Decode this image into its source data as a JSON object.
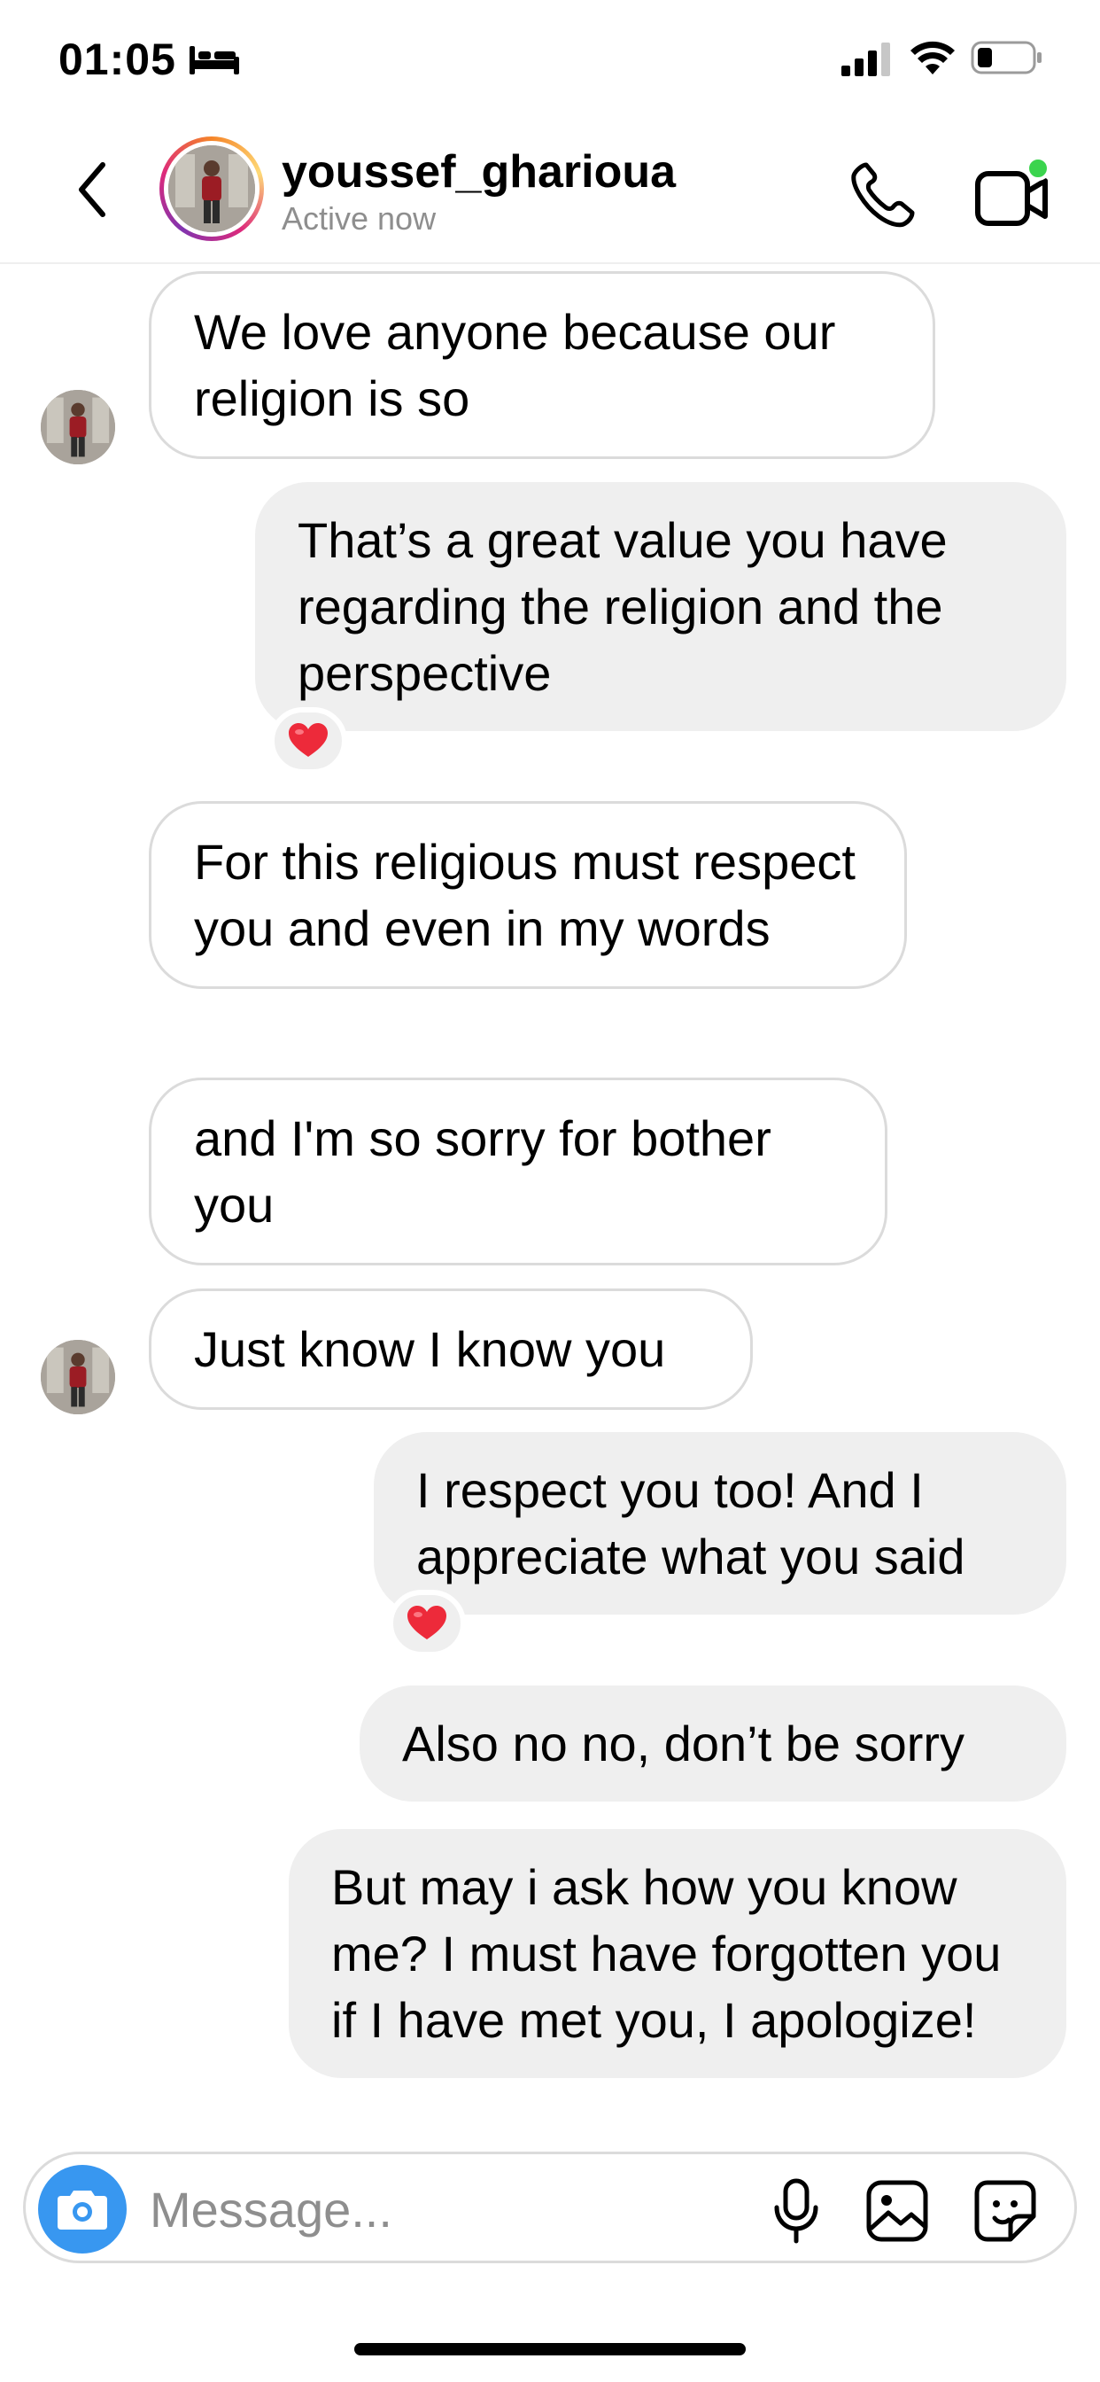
{
  "status_bar": {
    "time": "01:05",
    "icons": [
      "bed-icon",
      "signal-icon",
      "wifi-icon",
      "battery-icon"
    ]
  },
  "header": {
    "username": "youssef_gharioua",
    "status": "Active now",
    "icons": [
      "back-icon",
      "phone-icon",
      "video-icon"
    ],
    "video_badge_color": "#3bd44e"
  },
  "messages": [
    {
      "from": "them",
      "text": "We love anyone because our religion is so"
    },
    {
      "from": "me",
      "text": "That’s a great value you have regarding the religion and the perspective",
      "reaction": "❤️"
    },
    {
      "from": "them",
      "text": "For this religious must respect you and even in my words"
    },
    {
      "from": "them",
      "text": "and I'm so sorry for bother you"
    },
    {
      "from": "them",
      "text": "Just know I know you"
    },
    {
      "from": "me",
      "text": "I respect you too! And I appreciate what you said",
      "reaction": "❤️"
    },
    {
      "from": "me",
      "text": "Also no no, don’t be sorry"
    },
    {
      "from": "me",
      "text": "But may i ask how you know me? I must have forgotten you if I have met you, I apologize!"
    }
  ],
  "composer": {
    "placeholder": "Message...",
    "icons": [
      "camera-icon",
      "mic-icon",
      "gallery-icon",
      "sticker-icon"
    ],
    "camera_color": "#3897f0"
  }
}
